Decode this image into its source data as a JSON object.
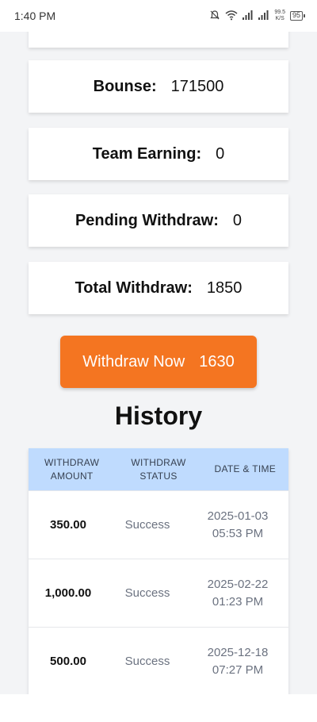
{
  "status_bar": {
    "time": "1:40 PM",
    "net_speed": "99.5\nK/S",
    "battery": "95"
  },
  "cards": [
    {
      "label": "",
      "value": ""
    },
    {
      "label": "Bounse:",
      "value": "171500"
    },
    {
      "label": "Team Earning:",
      "value": "0"
    },
    {
      "label": "Pending Withdraw:",
      "value": "0"
    },
    {
      "label": "Total Withdraw:",
      "value": "1850"
    }
  ],
  "withdraw_button": {
    "label": "Withdraw Now",
    "amount": "1630"
  },
  "history": {
    "title": "History",
    "columns": [
      "WITHDRAW AMOUNT",
      "WITHDRAW STATUS",
      "DATE & TIME"
    ],
    "rows": [
      {
        "amount": "350.00",
        "status": "Success",
        "date": "2025-01-03 05:53 PM"
      },
      {
        "amount": "1,000.00",
        "status": "Success",
        "date": "2025-02-22 01:23 PM"
      },
      {
        "amount": "500.00",
        "status": "Success",
        "date": "2025-12-18 07:27 PM"
      }
    ]
  }
}
